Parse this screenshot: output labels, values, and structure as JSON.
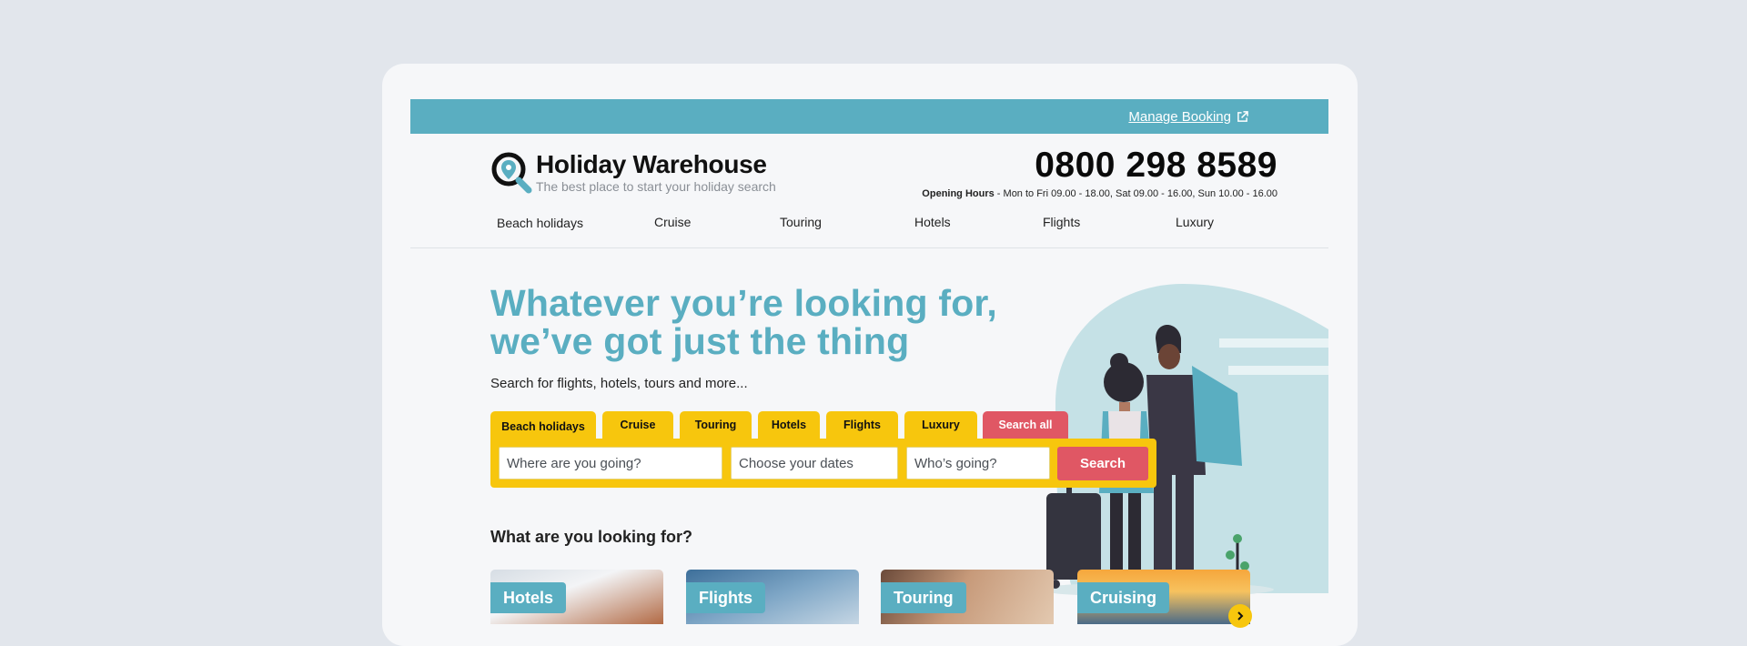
{
  "topbar": {
    "manage_booking": "Manage Booking",
    "icon": "external-link-icon"
  },
  "brand": {
    "name": "Holiday Warehouse",
    "tagline": "The best place to start your holiday search",
    "icon": "map-pin-search-icon"
  },
  "contact": {
    "phone": "0800 298 8589",
    "hours_label": "Opening Hours",
    "hours_text": " - Mon to Fri 09.00 - 18.00, Sat 09.00 - 16.00, Sun 10.00 - 16.00"
  },
  "nav": {
    "items": [
      "Beach holidays",
      "Cruise",
      "Touring",
      "Hotels",
      "Flights",
      "Luxury"
    ]
  },
  "hero": {
    "title_line1": "Whatever you’re looking for,",
    "title_line2": "we’ve got just the thing",
    "subtitle": "Search for flights, hotels, tours and more..."
  },
  "search": {
    "tabs": [
      "Beach holidays",
      "Cruise",
      "Touring",
      "Hotels",
      "Flights",
      "Luxury",
      "Search all"
    ],
    "active_tab": "Beach holidays",
    "destination_placeholder": "Where are you going?",
    "dates_placeholder": "Choose your dates",
    "guests_placeholder": "Who’s going?",
    "button": "Search"
  },
  "categories": {
    "title": "What are you looking for?",
    "cards": [
      "Hotels",
      "Flights",
      "Touring",
      "Cruising"
    ],
    "next_icon": "chevron-right-icon"
  },
  "colors": {
    "teal": "#5aaec1",
    "yellow": "#f7c60d",
    "coral": "#e05764"
  }
}
